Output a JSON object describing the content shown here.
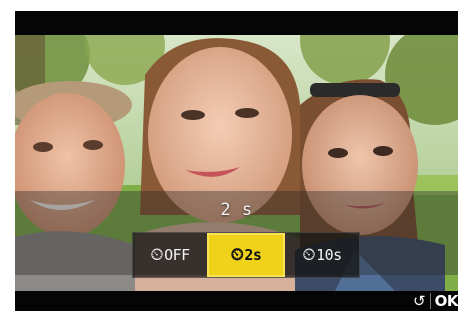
{
  "camera": {
    "current_value": "2 s",
    "options": [
      {
        "glyph": "⏲",
        "label": "OFF",
        "selected": false
      },
      {
        "glyph": "⏲",
        "label": "2s",
        "selected": true
      },
      {
        "glyph": "⏲",
        "label": "10s",
        "selected": false
      }
    ],
    "nav": {
      "back_glyph": "↺",
      "ok_label": "OK"
    },
    "colors": {
      "selected_bg": "#f0d21a",
      "bar": "#050505"
    }
  }
}
